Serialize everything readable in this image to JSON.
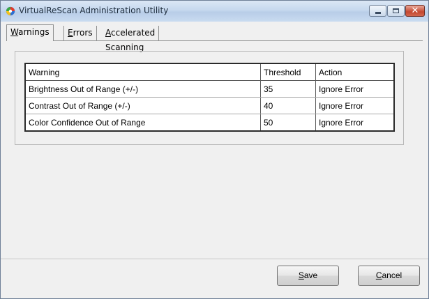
{
  "window": {
    "title": "VirtualReScan Administration Utility",
    "close_glyph": "✕"
  },
  "tabs": [
    {
      "prefix": "",
      "mnemonic": "W",
      "rest": "arnings",
      "active": true
    },
    {
      "prefix": "",
      "mnemonic": "E",
      "rest": "rrors",
      "active": false
    },
    {
      "prefix": "",
      "mnemonic": "A",
      "rest": "ccelerated Scanning",
      "active": false
    }
  ],
  "grid": {
    "columns": [
      "Warning",
      "Threshold",
      "Action"
    ],
    "rows": [
      {
        "warning": "Brightness Out of Range (+/-)",
        "threshold": "35",
        "action": "Ignore Error"
      },
      {
        "warning": "Contrast Out of Range (+/-)",
        "threshold": "40",
        "action": "Ignore Error"
      },
      {
        "warning": "Color Confidence Out of Range",
        "threshold": "50",
        "action": "Ignore Error"
      }
    ]
  },
  "buttons": {
    "save": {
      "mnemonic": "S",
      "rest": "ave"
    },
    "cancel": {
      "mnemonic": "C",
      "rest": "ancel"
    }
  },
  "colors": {
    "titlebar": "#c6d8ee",
    "close_button": "#c5472f",
    "dialog_background": "#f0f0f0"
  }
}
